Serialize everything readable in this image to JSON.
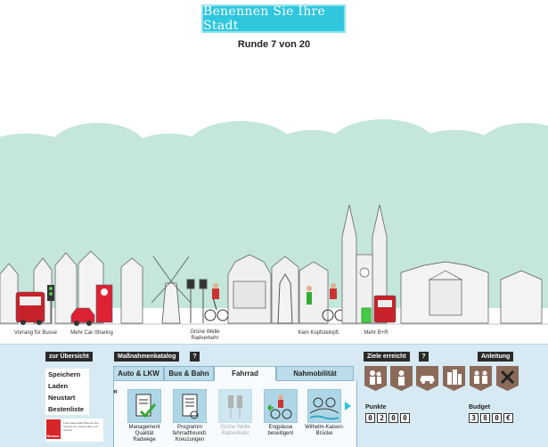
{
  "header": {
    "title_button": "Benennen Sie Ihre Stadt",
    "round": "Runde 7 von 20"
  },
  "scene": {
    "captions": {
      "bus": "Vorrang für Busse",
      "car_sharing": "Mehr Car-Sharing",
      "green_wave": "Grüne Welle Radverkehr",
      "no_cobble": "Kein Kopfsteinpfl.",
      "park_ride": "Mehr B+R"
    }
  },
  "left_menu": {
    "overview_label": "zur Übersicht",
    "items": [
      "Speichern",
      "Laden",
      "Neustart",
      "Bestenliste"
    ],
    "logo_word": "Bremen",
    "logo_text": "Freie Hansestadt Bremen Der Senator für Umwelt, Bau und Verkehr"
  },
  "catalog": {
    "title": "Maßnahmenkatalog",
    "help": "?",
    "tabs": [
      {
        "label": "Auto & LKW",
        "active": false
      },
      {
        "label": "Bus & Bahn",
        "active": false
      },
      {
        "label": "Fahrrad",
        "active": true
      },
      {
        "label": "Nahmobilität",
        "active": false
      }
    ],
    "prev": "«",
    "items": [
      {
        "label": "Management Qualität Radwege",
        "icon": "checklist-check-icon",
        "enabled": true
      },
      {
        "label": "Programm fahrradfreundl. Kreuzungen",
        "icon": "notebook-icon",
        "enabled": true
      },
      {
        "label": "Grüne Welle Radverkehr",
        "icon": "traffic-lights-icon",
        "enabled": false
      },
      {
        "label": "Engpässe beseitigen!",
        "icon": "cyclist-arrow-icon",
        "enabled": true
      },
      {
        "label": "Wilhelm-Kaisen-Brücke",
        "icon": "bridge-bike-icon",
        "enabled": true
      }
    ]
  },
  "goals": {
    "title": "Ziele erreicht",
    "help": "?",
    "instructions": "Anleitung",
    "icons": [
      "family-goal-icon",
      "person-goal-icon",
      "car-goal-icon",
      "city-goal-icon",
      "people-goal-icon",
      "cross-goal-icon"
    ],
    "points_label": "Punkte",
    "points_digits": [
      "0",
      "2",
      "0",
      "0"
    ],
    "budget_label": "Budget",
    "budget_digits": [
      "3",
      "8",
      "0",
      "€"
    ]
  },
  "colors": {
    "accent": "#2fc6de",
    "sky": "#bfe3d8",
    "panel": "#d7eaf3",
    "dark_tag": "#2a2a2a",
    "goal_brown": "#8b6a5a"
  }
}
